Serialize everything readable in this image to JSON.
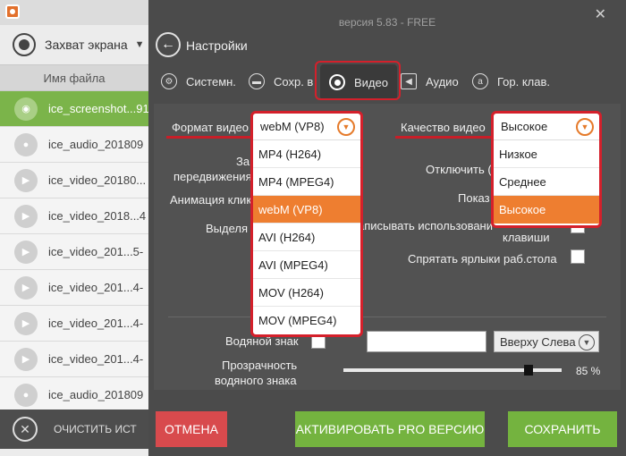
{
  "left": {
    "capture_label": "Захват экрана",
    "column_header": "Имя файла",
    "files": [
      "ice_screenshot...91",
      "ice_audio_201809",
      "ice_video_20180...",
      "ice_video_2018...4",
      "ice_video_201...5-",
      "ice_video_201...4-",
      "ice_video_201...4-",
      "ice_video_201...4-",
      "ice_audio_201809"
    ],
    "clear_label": "ОЧИСТИТЬ ИСТ"
  },
  "dialog": {
    "version": "версия 5.83 - FREE",
    "title": "Настройки",
    "tabs": [
      {
        "label": "Системн.",
        "icon": "gear-icon"
      },
      {
        "label": "Сохр. в",
        "icon": "folder-icon"
      },
      {
        "label": "Видео",
        "icon": "record-icon"
      },
      {
        "label": "Аудио",
        "icon": "speaker-icon"
      },
      {
        "label": "Гор. клав.",
        "icon": "hotkey-icon"
      }
    ],
    "video_format_label": "Формат видео",
    "video_quality_label": "Качество видео",
    "format_dropdown": {
      "selected": "webM (VP8)",
      "options": [
        "MP4 (H264)",
        "MP4 (MPEG4)",
        "webM (VP8)",
        "AVI (H264)",
        "AVI (MPEG4)",
        "MOV (H264)",
        "MOV (MPEG4)"
      ],
      "highlighted": "webM (VP8)"
    },
    "quality_dropdown": {
      "selected": "Высокое",
      "options": [
        "Низкое",
        "Среднее",
        "Высокое"
      ],
      "highlighted": "Высокое"
    },
    "partial_labels": {
      "zap": "Зап",
      "peredv": "передвижения",
      "anim": "Анимация клик",
      "vydel": "Выделя",
      "otkl": "Отключить (",
      "pokaz": "Показ",
      "zapis": "аписывать использовани",
      "klav": "клавиши"
    },
    "hide_desktop_label": "Спрятать ярлыки раб.стола",
    "watermark_label": "Водяной знак",
    "watermark_position": "Вверху Слева",
    "transparency_label_1": "Прозрачность",
    "transparency_label_2": "водяного знака",
    "transparency_value": "85 %",
    "transparency_fraction": 0.85,
    "cancel_label": "ОТМЕНА",
    "pro_label": "АКТИВИРОВАТЬ PRO ВЕРСИЮ",
    "save_label": "СОХРАНИТЬ"
  },
  "colors": {
    "accent_orange": "#ee7e30",
    "highlight_red": "#d4202b",
    "green": "#74b33f",
    "cancel_red": "#d84a4d"
  }
}
